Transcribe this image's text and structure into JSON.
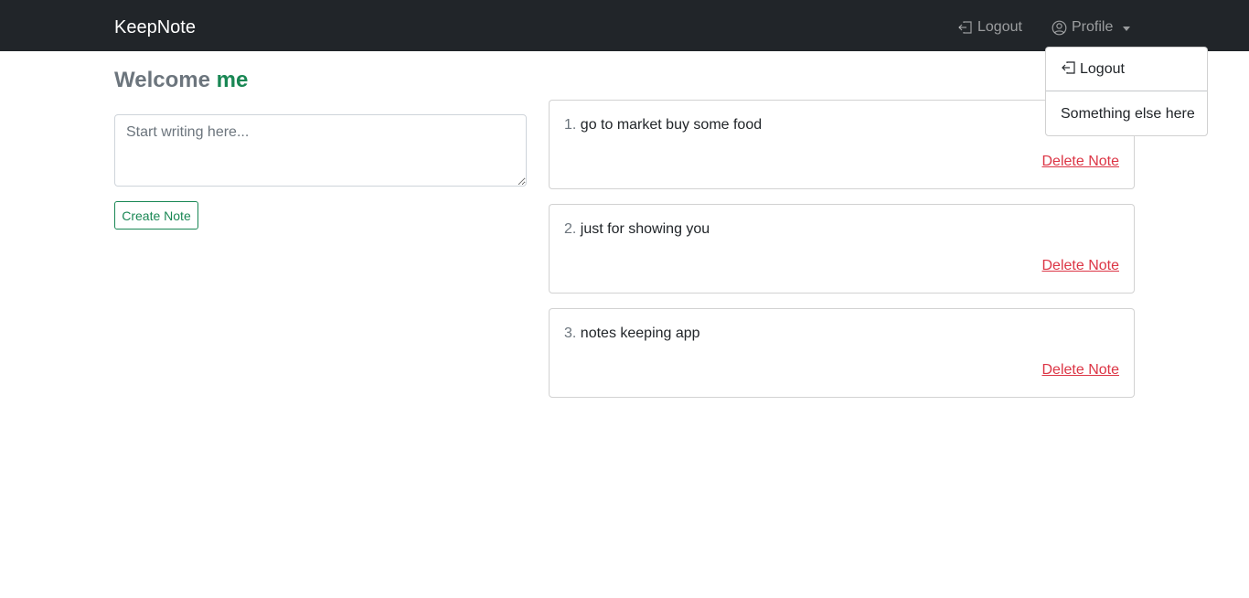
{
  "navbar": {
    "brand": "KeepNote",
    "logout_label": "Logout",
    "profile_label": "Profile"
  },
  "dropdown": {
    "items": [
      {
        "label": "Logout"
      },
      {
        "label": "Something else here"
      }
    ]
  },
  "welcome": {
    "prefix": "Welcome",
    "username": "me"
  },
  "composer": {
    "placeholder": "Start writing here...",
    "value": "",
    "create_label": "Create Note"
  },
  "notes": [
    {
      "number": "1.",
      "text": "go to market buy some food",
      "delete_label": "Delete Note"
    },
    {
      "number": "2.",
      "text": "just for showing you",
      "delete_label": "Delete Note"
    },
    {
      "number": "3.",
      "text": "notes keeping app",
      "delete_label": "Delete Note"
    }
  ],
  "colors": {
    "navbar_bg": "#212529",
    "accent_green": "#198754",
    "danger_red": "#dc3545",
    "muted": "#6c757d"
  },
  "icons": {
    "logout": "box-arrow-left-icon",
    "profile": "person-circle-icon",
    "dropdown_toggle": "caret-down-icon"
  }
}
